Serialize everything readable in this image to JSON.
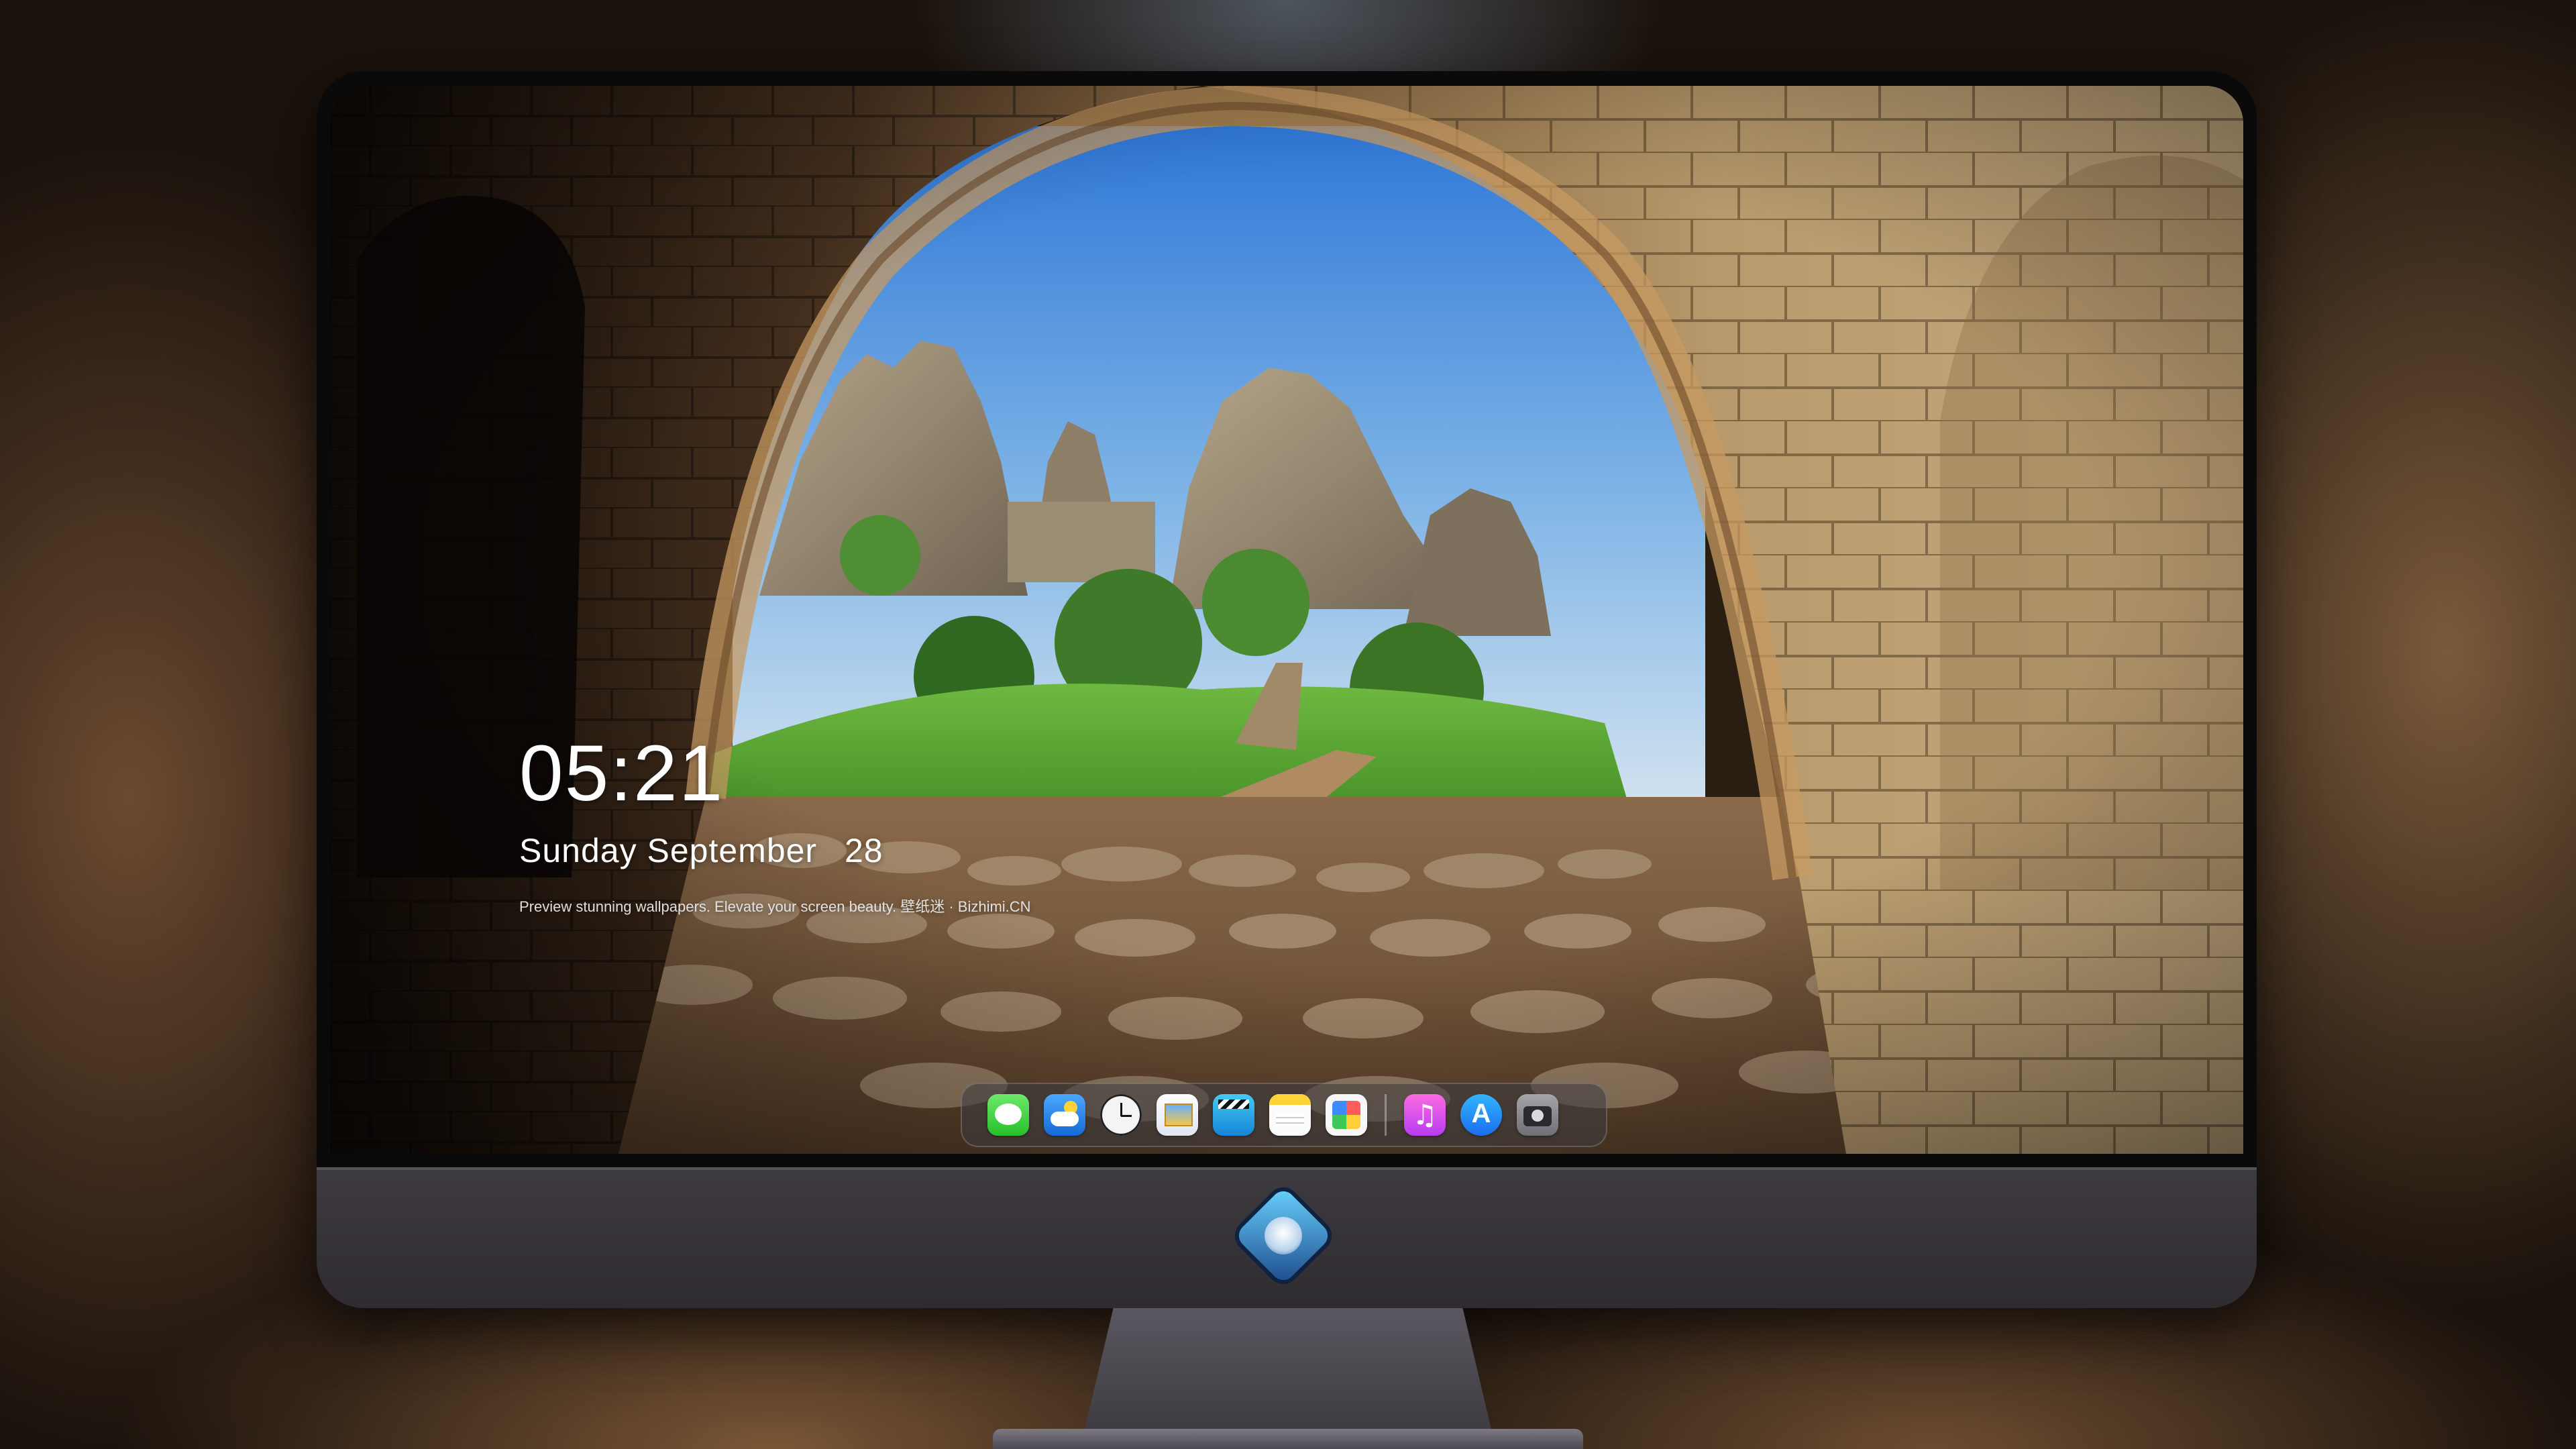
{
  "lock_screen": {
    "time": "05:21",
    "day_of_week": "Sunday",
    "month": "September",
    "day_number": "28",
    "tagline": "Preview stunning wallpapers. Elevate your screen beauty. 壁纸迷 · Bizhimi.CN"
  },
  "dock": {
    "apps": [
      {
        "name": "Messages",
        "icon": "messages-icon"
      },
      {
        "name": "Weather",
        "icon": "weather-icon"
      },
      {
        "name": "Clock",
        "icon": "clock-icon"
      },
      {
        "name": "Preview",
        "icon": "preview-icon"
      },
      {
        "name": "Claquette",
        "icon": "clapperboard-icon"
      },
      {
        "name": "Notes",
        "icon": "notes-icon"
      },
      {
        "name": "Photos",
        "icon": "photos-icon"
      },
      {
        "name": "Music",
        "icon": "music-icon"
      },
      {
        "name": "App Store",
        "icon": "app-store-icon"
      },
      {
        "name": "Camera",
        "icon": "camera-icon"
      }
    ]
  },
  "wallpaper": {
    "description_tags": [
      "stone-arch",
      "rock-formations",
      "blue-sky",
      "green-meadow",
      "cobblestones"
    ]
  },
  "monitor": {
    "logo_icon": "mascot-logo-icon"
  }
}
